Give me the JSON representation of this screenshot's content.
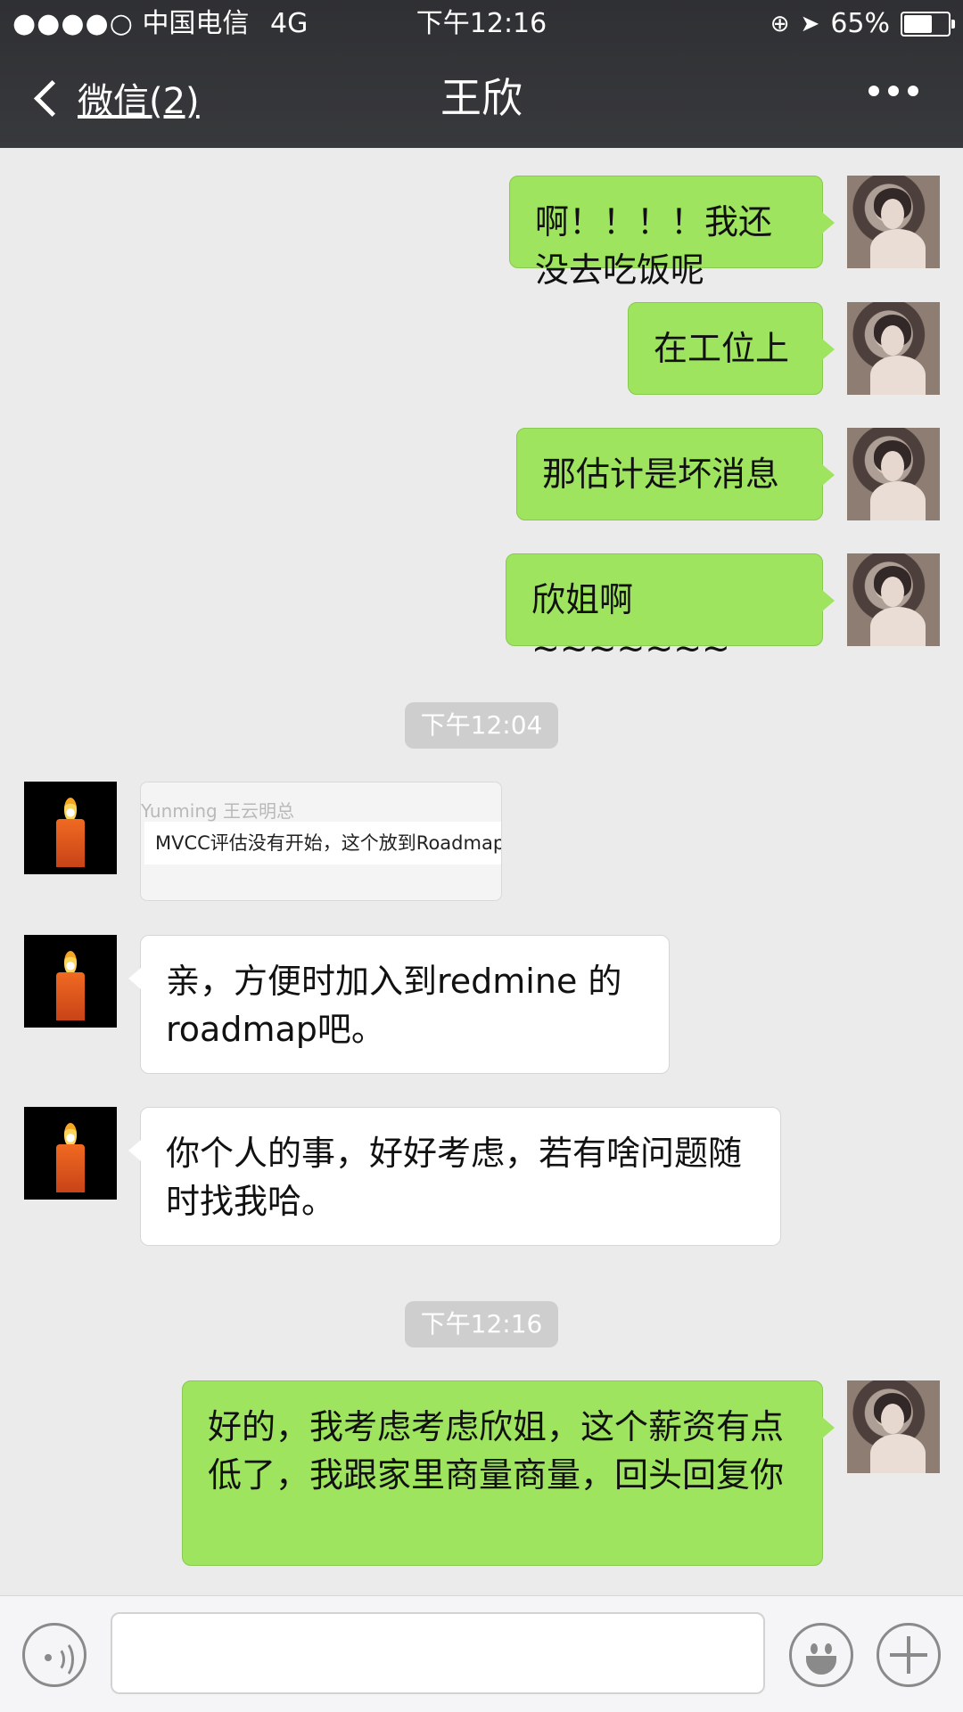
{
  "status_bar": {
    "signal": "●●●●○",
    "carrier": "中国电信",
    "network": "4G",
    "time": "下午12:16",
    "battery": "65%",
    "battery_level": 0.65
  },
  "nav": {
    "back_label": "微信(2)",
    "title": "王欣"
  },
  "messages": {
    "m1": "啊！！！！我还没去吃饭呢",
    "m2": "在工位上",
    "m3": "那估计是坏消息",
    "m4": "欣姐啊~~~~~~~",
    "t1": "下午12:04",
    "quote_author": "Yunming 王云明总",
    "quote_text": "MVCC评估没有开始，这个放到Roadmap",
    "m5": "亲，方便时加入到redmine 的roadmap吧。",
    "m6": "你个人的事，好好考虑，若有啥问题随时找我哈。",
    "t2": "下午12:16",
    "m7": "好的，我考虑考虑欣姐，这个薪资有点低了，我跟家里商量商量，回头回复你"
  },
  "icons": {
    "back": "chevron-left-icon",
    "more": "more-dots-icon",
    "voice": "voice-icon",
    "emoji": "emoji-icon",
    "plus": "plus-icon"
  },
  "colors": {
    "header": "#343538",
    "chat_bg": "#ebebeb",
    "my_bubble": "#9ee45e",
    "other_bubble": "#ffffff"
  }
}
